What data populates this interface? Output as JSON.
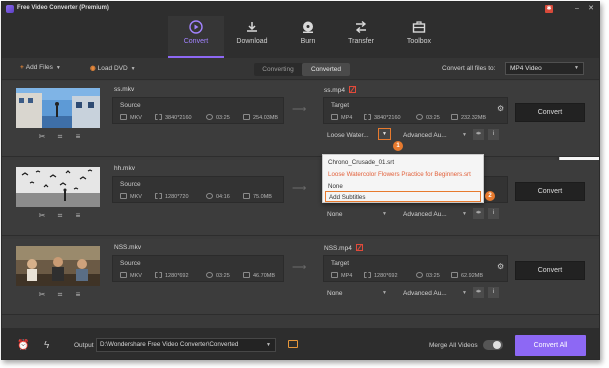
{
  "app": {
    "title": "Free Video Converter (Premium)"
  },
  "nav": {
    "tabs": [
      {
        "label": "Convert",
        "icon": "convert-icon",
        "active": true
      },
      {
        "label": "Download",
        "icon": "download-icon"
      },
      {
        "label": "Burn",
        "icon": "burn-icon"
      },
      {
        "label": "Transfer",
        "icon": "transfer-icon"
      },
      {
        "label": "Toolbox",
        "icon": "toolbox-icon"
      }
    ]
  },
  "toolbar": {
    "add_files": "Add Files",
    "load_dvd": "Load DVD",
    "seg_converting": "Converting",
    "seg_converted": "Converted",
    "convert_all_label": "Convert all files to:",
    "convert_all_value": "MP4 Video"
  },
  "files": [
    {
      "name": "ss.mkv",
      "source_label": "Source",
      "source": {
        "format": "MKV",
        "resolution": "3840*2160",
        "duration": "03:25",
        "size": "254.03MB"
      },
      "target_name": "ss.mp4",
      "target_label": "Target",
      "target": {
        "format": "MP4",
        "resolution": "3840*2160",
        "duration": "03:25",
        "size": "232.32MB"
      },
      "subtitle": "Loose Water...",
      "audio": "Advanced Au...",
      "convert": "Convert"
    },
    {
      "name": "hh.mkv",
      "source_label": "Source",
      "source": {
        "format": "MKV",
        "resolution": "1280*720",
        "duration": "04:16",
        "size": "75.0MB"
      },
      "subtitle": "None",
      "audio": "Advanced Au...",
      "convert": "Convert"
    },
    {
      "name": "NSS.mkv",
      "source_label": "Source",
      "source": {
        "format": "MKV",
        "resolution": "1280*692",
        "duration": "03:25",
        "size": "46.70MB"
      },
      "target_name": "NSS.mp4",
      "target_label": "Target",
      "target": {
        "format": "MP4",
        "resolution": "1280*692",
        "duration": "03:25",
        "size": "62.92MB"
      },
      "subtitle": "None",
      "audio": "Advanced Au...",
      "convert": "Convert"
    }
  ],
  "subtitle_menu": {
    "items": [
      "Chrono_Crusade_01.srt",
      "Loose Watercolor Flowers  Practice for Beginners.srt",
      "None",
      "Add Subtitles"
    ],
    "badges": [
      "1",
      "2"
    ]
  },
  "bottom": {
    "output_label": "Output",
    "output_path": "D:\\Wondershare Free Video Converter\\Converted",
    "merge_label": "Merge All Videos",
    "merge_on": false,
    "convert_all_button": "Convert All"
  },
  "colors": {
    "accent": "#8d68f4",
    "highlight": "#e77a2e",
    "warn": "#e24a3a"
  }
}
